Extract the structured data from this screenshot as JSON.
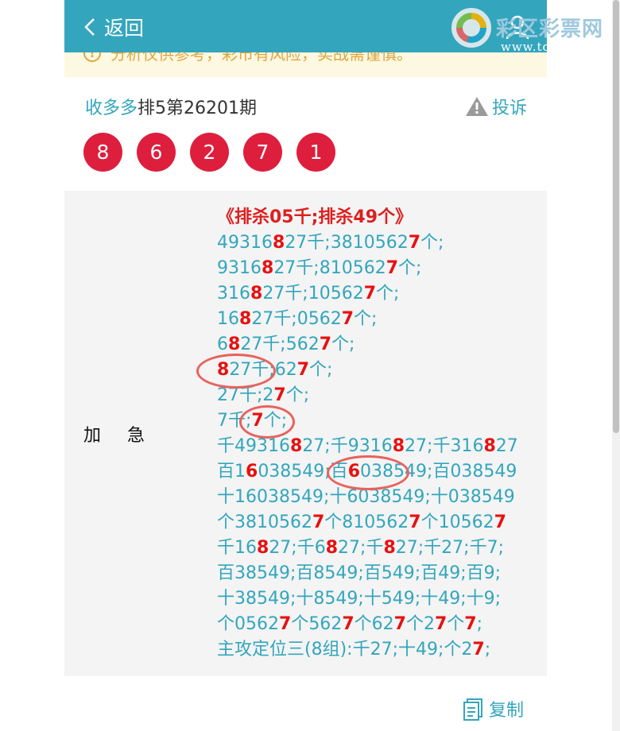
{
  "header": {
    "back_label": "返回",
    "logo_brand": "彩区彩票网",
    "logo_url": "www.tqcp.net"
  },
  "notice": {
    "text": "分析仅供参考，彩市有风险，实战需谨慎。"
  },
  "title": {
    "source": "收多多",
    "issue": "排5第26201期",
    "complain_label": "投诉"
  },
  "balls": [
    "8",
    "6",
    "2",
    "7",
    "1"
  ],
  "content": {
    "label": "加急",
    "heading": "《排杀05千;排杀49个》",
    "lines": [
      [
        [
          "4931",
          0
        ],
        [
          "6",
          0
        ],
        [
          "8",
          1
        ],
        [
          "27千;381056",
          0
        ],
        [
          "2",
          0
        ],
        [
          "7",
          1
        ],
        [
          "个;",
          0
        ]
      ],
      [
        [
          "9316",
          0
        ],
        [
          "8",
          1
        ],
        [
          "27千;810562",
          0
        ],
        [
          "7",
          1
        ],
        [
          "个;",
          0
        ]
      ],
      [
        [
          "316",
          0
        ],
        [
          "8",
          1
        ],
        [
          "27千;10562",
          0
        ],
        [
          "7",
          1
        ],
        [
          "个;",
          0
        ]
      ],
      [
        [
          "16",
          0
        ],
        [
          "8",
          1
        ],
        [
          "27千;0562",
          0
        ],
        [
          "7",
          1
        ],
        [
          "个;",
          0
        ]
      ],
      [
        [
          "6",
          0
        ],
        [
          "8",
          1
        ],
        [
          "27千;562",
          0
        ],
        [
          "7",
          1
        ],
        [
          "个;",
          0
        ]
      ],
      [
        [
          "8",
          1
        ],
        [
          "27千;62",
          0
        ],
        [
          "7",
          1
        ],
        [
          "个;",
          0
        ]
      ],
      [
        [
          "27千;2",
          0
        ],
        [
          "7",
          1
        ],
        [
          "个;",
          0
        ]
      ],
      [
        [
          "7千;",
          0
        ],
        [
          "7",
          1
        ],
        [
          "个;",
          0
        ]
      ],
      [
        [
          "千4931",
          0
        ],
        [
          "6",
          0
        ],
        [
          "8",
          1
        ],
        [
          "27;千931",
          0
        ],
        [
          "6",
          0
        ],
        [
          "8",
          1
        ],
        [
          "27;千31",
          0
        ],
        [
          "6",
          0
        ],
        [
          "8",
          1
        ],
        [
          "27",
          0
        ]
      ],
      [
        [
          "百1",
          0
        ],
        [
          "6",
          1
        ],
        [
          "038549;百",
          0
        ],
        [
          "6",
          1
        ],
        [
          "038549;百038549",
          0
        ]
      ],
      [
        [
          "十16038549;十6038549;十038549",
          0
        ]
      ],
      [
        [
          "个381056",
          0
        ],
        [
          "2",
          0
        ],
        [
          "7",
          1
        ],
        [
          "个810562",
          0
        ],
        [
          "7",
          1
        ],
        [
          "个10562",
          0
        ],
        [
          "7",
          1
        ]
      ],
      [
        [
          "千16",
          0
        ],
        [
          "8",
          1
        ],
        [
          "27;千6",
          0
        ],
        [
          "8",
          1
        ],
        [
          "27;千",
          0
        ],
        [
          "8",
          1
        ],
        [
          "27;千27;千7;",
          0
        ]
      ],
      [
        [
          "百38549;百8549;百549;百49;百9;",
          0
        ]
      ],
      [
        [
          "十38549;十8549;十549;十49;十9;",
          0
        ]
      ],
      [
        [
          "个0562",
          0
        ],
        [
          "7",
          1
        ],
        [
          "个562",
          0
        ],
        [
          "7",
          1
        ],
        [
          "个62",
          0
        ],
        [
          "7",
          1
        ],
        [
          "个2",
          0
        ],
        [
          "7",
          1
        ],
        [
          "个",
          0
        ],
        [
          "7",
          1
        ],
        [
          ";",
          0
        ]
      ],
      [
        [
          "主攻定位三(8组):千27;十49;个2",
          0
        ],
        [
          "7",
          1
        ],
        [
          ";",
          0
        ]
      ]
    ]
  },
  "footer": {
    "copy_label": "复制"
  },
  "colors": {
    "header_bg": "#33a6bd",
    "ball_red": "#dd1f3d",
    "highlight_red": "#e81010",
    "notice_text": "#e0a53b"
  }
}
